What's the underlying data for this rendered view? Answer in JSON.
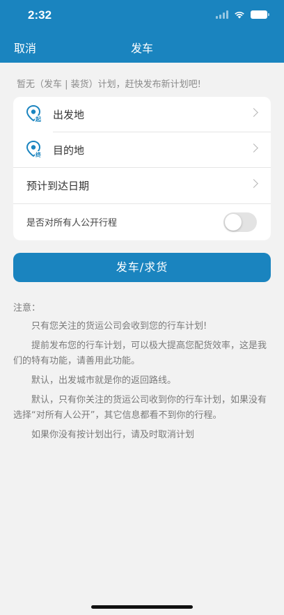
{
  "status_bar": {
    "time": "2:32"
  },
  "nav": {
    "cancel_label": "取消",
    "title": "发车"
  },
  "hint": "暂无（发车 | 装货）计划，赶快发布新计划吧!",
  "form": {
    "origin_label": "出发地",
    "origin_badge": "起",
    "destination_label": "目的地",
    "destination_badge": "终",
    "arrival_date_label": "预计到达日期",
    "public_label": "是否对所有人公开行程",
    "public_enabled": false
  },
  "submit_label": "发车/求货",
  "notes": {
    "title": "注意：",
    "items": [
      "只有您关注的货运公司会收到您的行车计划!",
      "提前发布您的行车计划，可以极大提高您配货效率，这是我们的特有功能，请善用此功能。",
      "默认，出发城市就是你的返回路线。",
      "默认，只有你关注的货运公司收到你的行车计划，如果没有选择“对所有人公开”，其它信息都看不到你的行程。",
      "如果你没有按计划出行，请及时取消计划"
    ]
  },
  "colors": {
    "brand": "#1a84bf",
    "background": "#f2f2f2"
  }
}
